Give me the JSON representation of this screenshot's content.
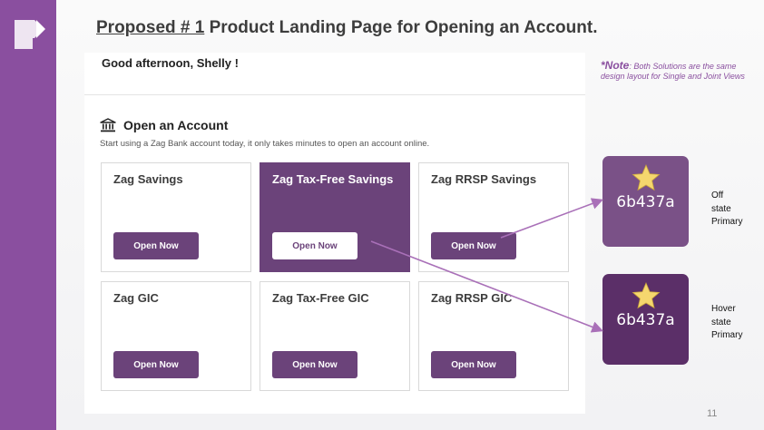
{
  "slide": {
    "title_underlined": "Proposed # 1",
    "title_rest": " Product Landing Page for Opening an Account.",
    "page_number": "11"
  },
  "note": {
    "label": "*Note",
    "body": ": Both Solutions are the same design layout for Single and Joint Views"
  },
  "app": {
    "greeting": "Good afternoon, Shelly !",
    "section_title": "Open an Account",
    "section_subtitle": "Start using a Zag Bank account today, it only takes minutes to open an account online.",
    "section_icon": "bank-icon",
    "cards": [
      {
        "title": "Zag Savings",
        "button": "Open Now",
        "selected": false
      },
      {
        "title": "Zag Tax-Free Savings",
        "button": "Open Now",
        "selected": true
      },
      {
        "title": "Zag RRSP Savings",
        "button": "Open Now",
        "selected": false
      },
      {
        "title": "Zag GIC",
        "button": "Open Now",
        "selected": false
      },
      {
        "title": "Zag Tax-Free GIC",
        "button": "Open Now",
        "selected": false
      },
      {
        "title": "Zag RRSP GIC",
        "button": "Open Now",
        "selected": false
      }
    ]
  },
  "swatches": {
    "off": {
      "hex": "6b437a",
      "line1": "Off",
      "line2": "state",
      "line3": "Primary",
      "icon": "star-icon"
    },
    "hover": {
      "hex": "6b437a",
      "line1": "Hover",
      "line2": "state",
      "line3": "Primary",
      "icon": "star-icon"
    }
  },
  "colors": {
    "primary": "#6b437a",
    "sidebar": "#8a4f9f",
    "swatch_off": "#7a5187",
    "swatch_hover": "#5b2f68",
    "annotation_arrow": "#a970b8",
    "star": "#f5d76e"
  }
}
